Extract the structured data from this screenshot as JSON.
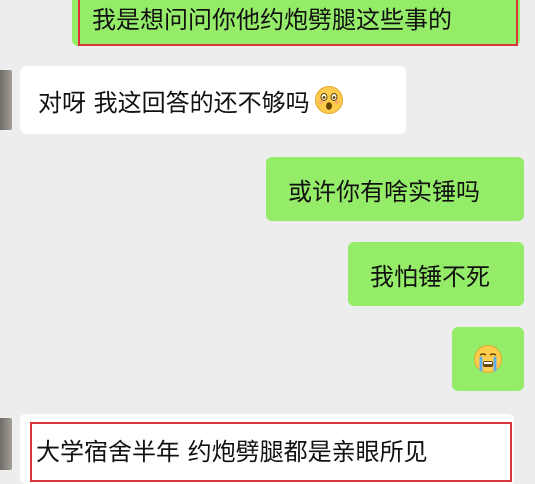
{
  "messages": [
    {
      "side": "outgoing",
      "text": "我是想问问你他约炮劈腿这些事的",
      "highlighted": true
    },
    {
      "side": "incoming",
      "text": "对呀 我这回答的还不够吗",
      "emoji": "astonished-face-emoji"
    },
    {
      "side": "outgoing",
      "text": "或许你有啥实锤吗"
    },
    {
      "side": "outgoing",
      "text": "我怕锤不死"
    },
    {
      "side": "outgoing",
      "text": "",
      "emoji": "crying-face-emoji"
    },
    {
      "side": "incoming",
      "text": "大学宿舍半年 约炮劈腿都是亲眼所见",
      "highlighted": true
    }
  ],
  "colors": {
    "background": "#ededed",
    "outgoing_bubble": "#95ec69",
    "incoming_bubble": "#ffffff",
    "highlight_border": "#d8343a"
  }
}
